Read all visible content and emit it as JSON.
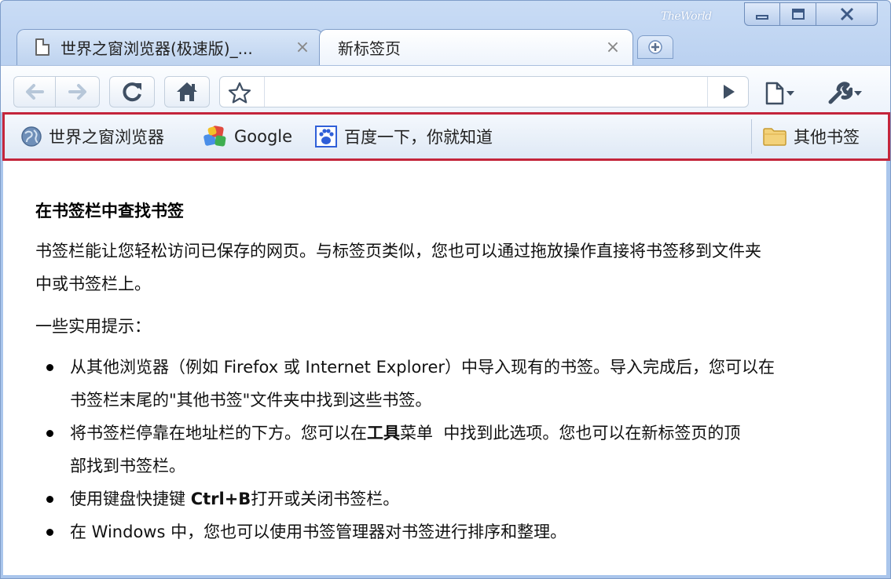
{
  "window": {
    "brand": "TheWorld",
    "controls": {
      "minimize": "minimize",
      "maximize": "maximize",
      "close": "close"
    }
  },
  "tabs": [
    {
      "title": "世界之窗浏览器(极速版)_...",
      "active": false,
      "icon": "page-icon"
    },
    {
      "title": "新标签页",
      "active": true
    }
  ],
  "toolbar": {
    "back_icon": "back-arrow-icon",
    "forward_icon": "forward-arrow-icon",
    "reload_icon": "reload-icon",
    "home_icon": "home-icon",
    "star_icon": "star-icon",
    "address_value": "",
    "go_icon": "play-icon",
    "page_menu_icon": "page-menu-icon",
    "tools_menu_icon": "wrench-icon"
  },
  "bookmarks_bar": {
    "items": [
      {
        "label": "世界之窗浏览器",
        "icon": "globe-icon"
      },
      {
        "label": "Google",
        "icon": "google-icon"
      },
      {
        "label": "百度一下，你就知道",
        "icon": "baidu-paw-icon"
      }
    ],
    "other": {
      "label": "其他书签",
      "icon": "folder-icon"
    }
  },
  "content": {
    "heading": "在书签栏中查找书签",
    "paragraph1_line1": "书签栏能让您轻松访问已保存的网页。与标签页类似，您也可以通过拖放操作直接将书签移到文件夹",
    "paragraph1_line2": "中或书签栏上。",
    "tips_intro": "一些实用提示：",
    "tips": [
      {
        "line1": "从其他浏览器（例如 Firefox 或 Internet Explorer）中导入现有的书签。导入完成后，您可以在",
        "line2": "书签栏末尾的\"其他书签\"文件夹中找到这些书签。"
      },
      {
        "pre": "将书签栏停靠在地址栏的下方。您可以在",
        "bold": "工具",
        "post": "菜单  中找到此选项。您也可以在新标签页的顶",
        "line2": "部找到书签栏。"
      },
      {
        "pre": "使用键盘快捷键 ",
        "bold": "Ctrl+B",
        "post": "打开或关闭书签栏。"
      },
      {
        "line1": "在 Windows 中，您也可以使用书签管理器对书签进行排序和整理。"
      }
    ]
  },
  "colors": {
    "frame": "#aac6ec",
    "highlight_border": "#c4253b",
    "toolbar_bg": "#f4f8fd"
  }
}
